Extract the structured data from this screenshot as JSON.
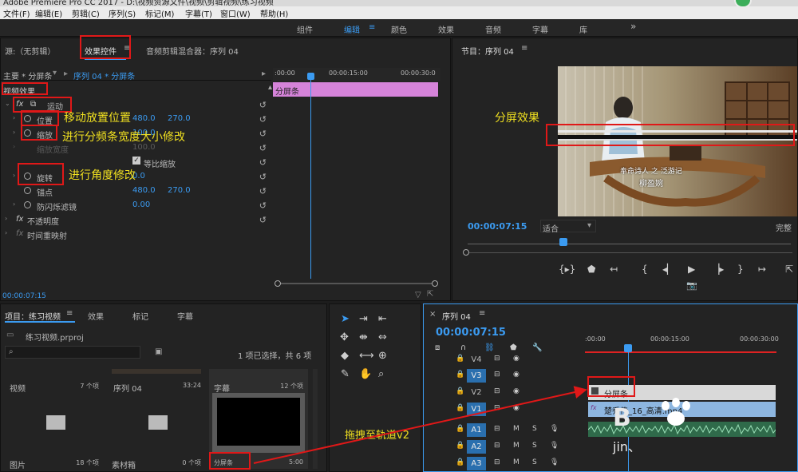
{
  "window": {
    "title": "Adobe Premiere Pro CC 2017 - D:\\视频资源文件\\视频\\剪辑视频\\练习视频"
  },
  "menu": [
    "文件(F)",
    "编辑(E)",
    "剪辑(C)",
    "序列(S)",
    "标记(M)",
    "字幕(T)",
    "窗口(W)",
    "帮助(H)"
  ],
  "workspaces": {
    "items": [
      "组件",
      "编辑",
      "颜色",
      "效果",
      "音频",
      "字幕",
      "库"
    ],
    "active": "编辑",
    "more": "»"
  },
  "effects_panel": {
    "tabs": [
      "源:（无剪辑）",
      "效果控件",
      "音频剪辑混合器：序列 04"
    ],
    "menu_icon": "≡",
    "clip_path_main": "主要 * 分屏条",
    "clip_path_seq": "序列 04 * 分屏条",
    "section": "视频效果",
    "ruler": {
      "t0": ":00:00",
      "t1": "00:00:15:00",
      "t2": "00:00:30:0"
    },
    "clip_bar_label": "分屏条",
    "motion": "运动",
    "params": {
      "position": {
        "label": "位置",
        "x": "480.0",
        "y": "270.0"
      },
      "scale": {
        "label": "缩放",
        "value": "100.0"
      },
      "scale_width": {
        "label": "缩放宽度",
        "value": "100.0"
      },
      "uniform_label": "等比缩放",
      "rotation": {
        "label": "旋转",
        "value": "0.0"
      },
      "anchor": {
        "label": "锚点",
        "x": "480.0",
        "y": "270.0"
      },
      "flicker": {
        "label": "防闪烁滤镜",
        "value": "0.00"
      }
    },
    "opacity": "不透明度",
    "time_remap": "时间重映射",
    "timecode": "00:00:07:15"
  },
  "program_monitor": {
    "title": "节目：序列 04",
    "menu_icon": "≡",
    "timecode": "00:00:07:15",
    "fit": "适合",
    "complete": "完整",
    "subtitle_1": "奉命诗人 之 泛游记",
    "subtitle_2": "柳盈婉"
  },
  "project_panel": {
    "tabs": [
      "项目：练习视频",
      "效果",
      "标记",
      "字幕"
    ],
    "menu_icon": "≡",
    "file": "练习视频.prproj",
    "selection": "1 项已选择，共 6 项",
    "bins": [
      {
        "name": "视频",
        "count": "7 个项",
        "kind": "folder"
      },
      {
        "name": "序列 04",
        "count": "33:24",
        "kind": "sequence"
      },
      {
        "name": "字幕",
        "count": "12 个项",
        "kind": "folder-header"
      },
      {
        "name": "图片",
        "count": "18 个项",
        "kind": "folder"
      },
      {
        "name": "素材箱",
        "count": "0 个项",
        "kind": "folder"
      },
      {
        "name": "分屏条",
        "count": "5:00",
        "kind": "clip"
      }
    ]
  },
  "timeline": {
    "tab": "序列 04",
    "close": "×",
    "menu_icon": "≡",
    "timecode": "00:00:07:15",
    "ruler": {
      "t0": ":00:00",
      "t1": "00:00:15:00",
      "t2": "00:00:30:00"
    },
    "tracks": [
      {
        "name": "V4",
        "active": false
      },
      {
        "name": "V3",
        "active": true
      },
      {
        "name": "V2",
        "active": false
      },
      {
        "name": "V1",
        "active": true
      },
      {
        "name": "A1",
        "active": true
      },
      {
        "name": "A2",
        "active": true
      },
      {
        "name": "A3",
        "active": true
      }
    ],
    "clip_v2": "分屏条",
    "clip_v1": "楚乔传_16_高清.mp4",
    "m_label": "M",
    "s_label": "S"
  },
  "annotations": {
    "move": "移动放置位置",
    "scale": "进行分频条宽度大小修改",
    "rotate": "进行角度修改",
    "split": "分屏效果",
    "drag": "拖拽至轨道v2"
  },
  "watermark": {
    "line1": "B",
    "line2": "jin、"
  },
  "colors": {
    "accent": "#3b9bf1",
    "annotation": "#e01818",
    "note": "#f0e020",
    "clip_pink": "#d583d9"
  }
}
